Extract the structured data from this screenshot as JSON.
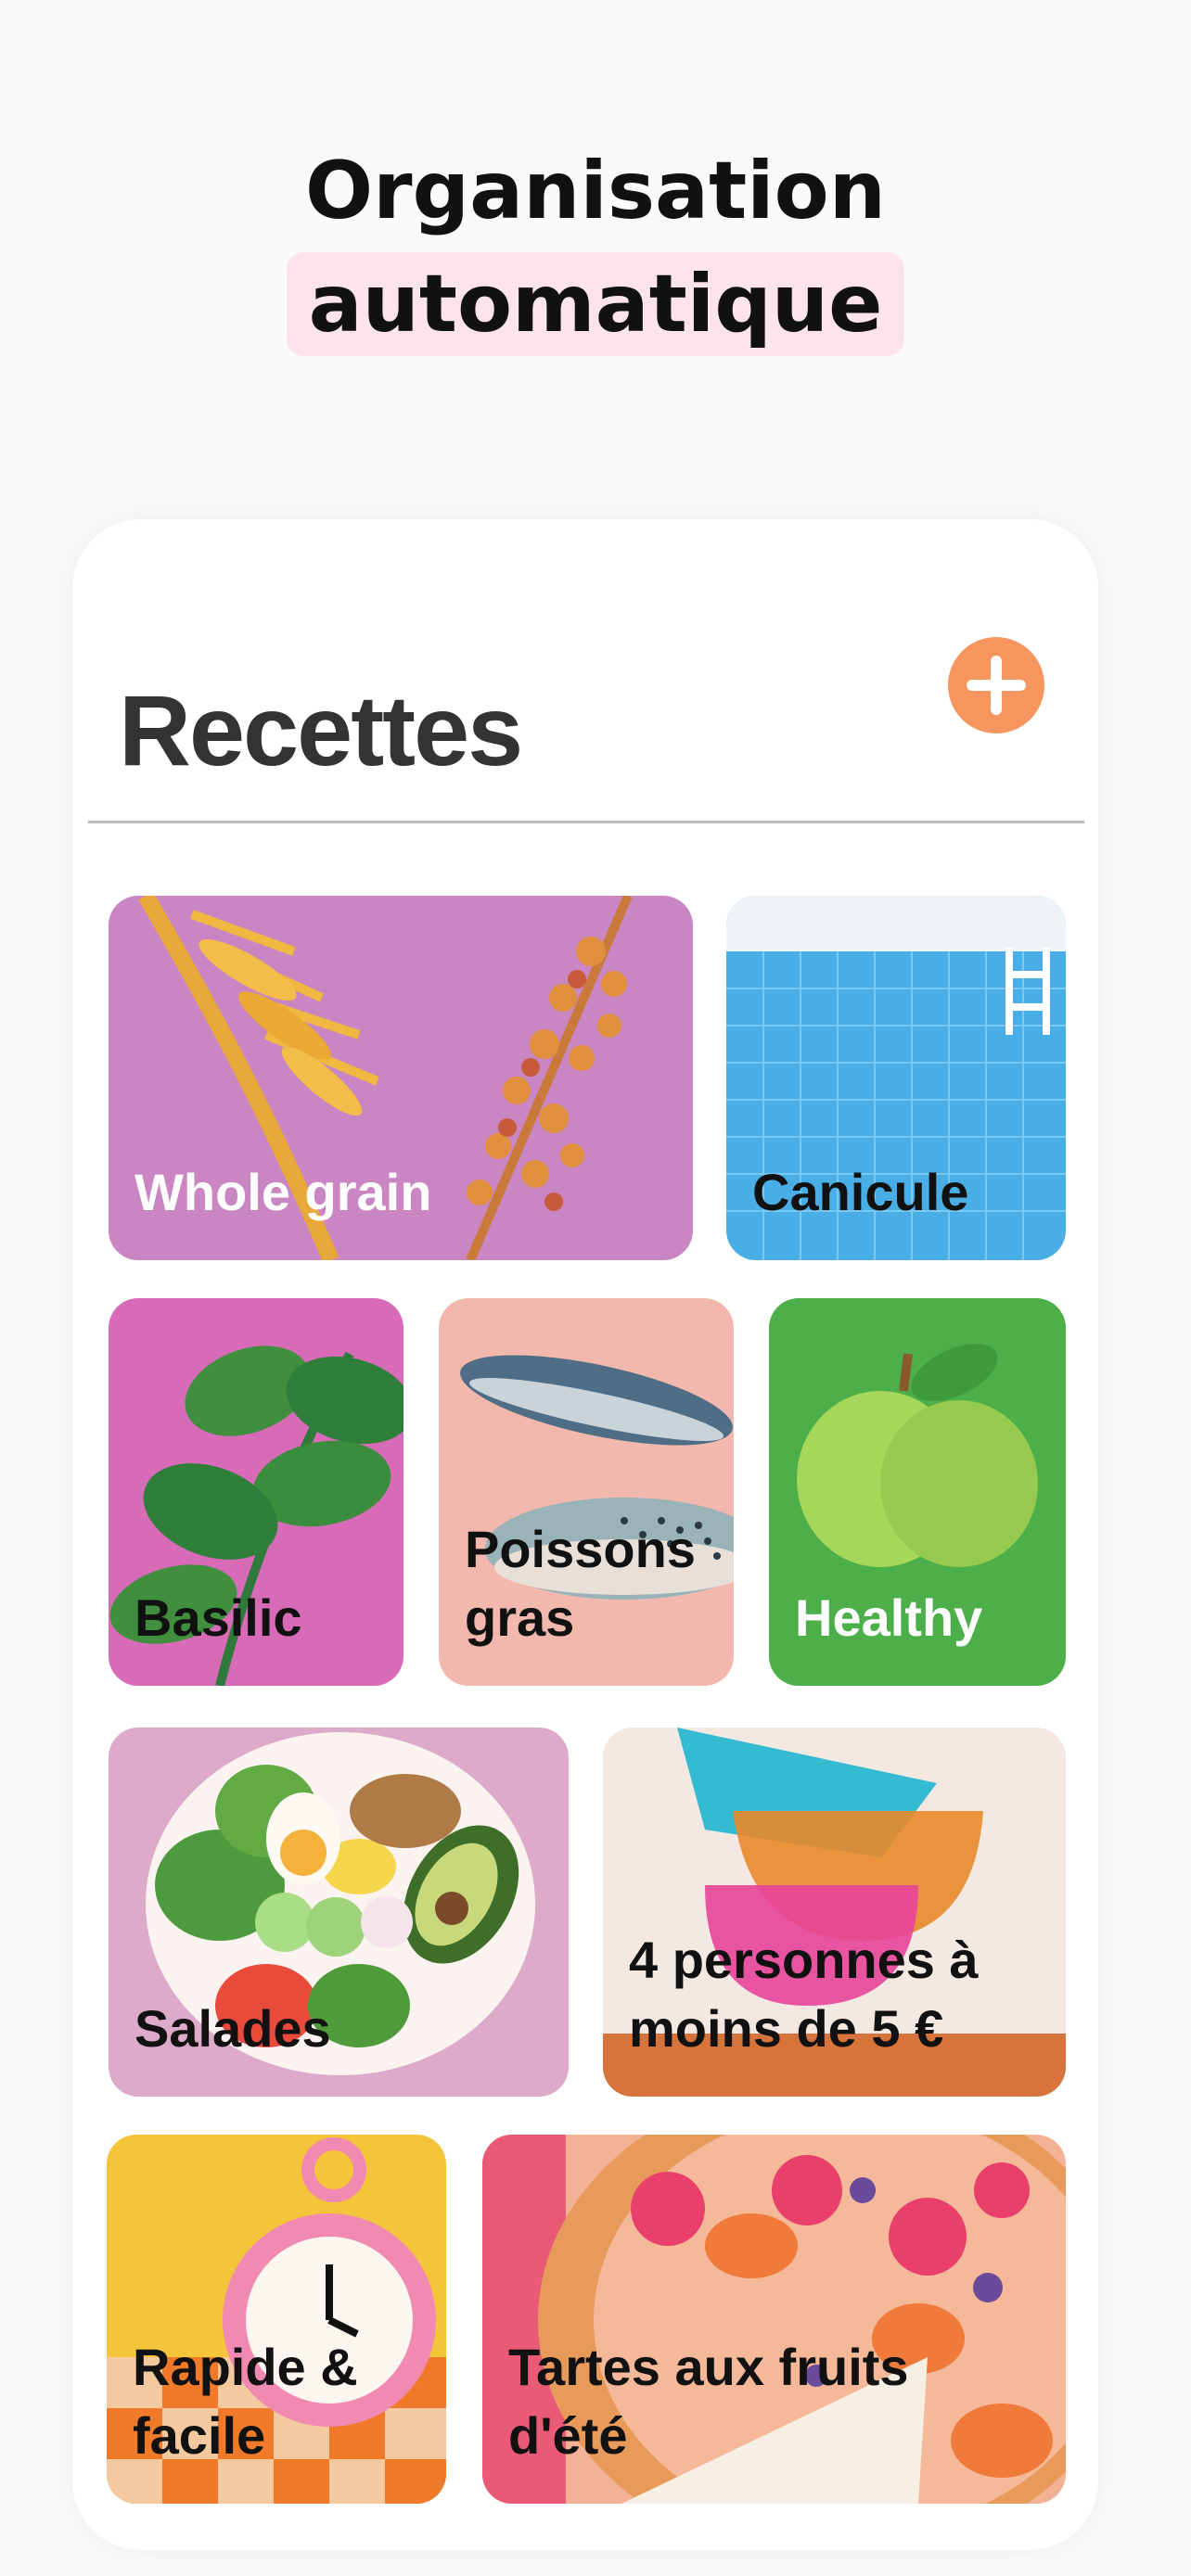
{
  "headline": {
    "line1": "Organisation",
    "line2": "automatique"
  },
  "screen": {
    "title": "Recettes"
  },
  "colors": {
    "accent": "#f7955f",
    "highlight": "#fde4ec",
    "title_text": "#333333"
  },
  "add_button": {
    "icon": "plus-icon"
  },
  "categories": [
    {
      "label": "Whole grain",
      "text_color": "#ffffff"
    },
    {
      "label": "Canicule",
      "text_color": "#111111"
    },
    {
      "label": "Basilic",
      "text_color": "#111111"
    },
    {
      "label": "Poissons\ngras",
      "text_color": "#111111"
    },
    {
      "label": "Healthy",
      "text_color": "#ffffff"
    },
    {
      "label": "Salades",
      "text_color": "#111111"
    },
    {
      "label": "4 personnes à\nmoins de 5 €",
      "text_color": "#111111"
    },
    {
      "label": "Rapide &\nfacile",
      "text_color": "#111111"
    },
    {
      "label": "Tartes aux fruits\nd'été",
      "text_color": "#111111"
    }
  ]
}
